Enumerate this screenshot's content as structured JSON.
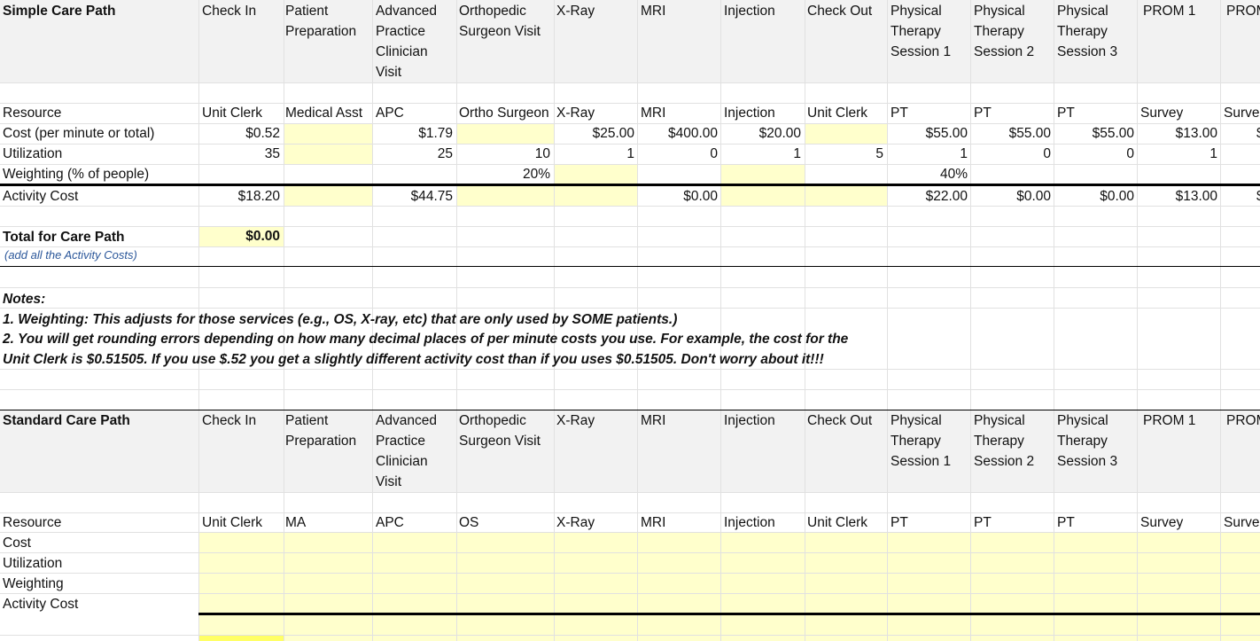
{
  "simple": {
    "title": "Simple Care Path",
    "headers": [
      "Check In",
      "Patient\nPreparation",
      "Advanced\nPractice\nClinician\nVisit",
      "Orthopedic\nSurgeon Visit",
      "X-Ray",
      "MRI",
      "Injection",
      "Check Out",
      "Physical\nTherapy\nSession 1",
      "Physical\nTherapy\nSession 2",
      "Physical\nTherapy\nSession 3",
      "PROM 1",
      "PROM"
    ],
    "row_labels": {
      "resource": "Resource",
      "cost": "Cost (per minute or total)",
      "utilization": "Utilization",
      "weighting": "Weighting (% of people)",
      "activity": "Activity Cost"
    },
    "resource": [
      "Unit Clerk",
      "Medical Asst",
      "APC",
      "Ortho Surgeon",
      "X-Ray",
      "MRI",
      "Injection",
      "Unit Clerk",
      "PT",
      "PT",
      "PT",
      "Survey",
      "Surve"
    ],
    "cost": [
      "$0.52",
      "",
      "$1.79",
      "",
      "$25.00",
      "$400.00",
      "$20.00",
      "",
      "$55.00",
      "$55.00",
      "$55.00",
      "$13.00",
      "$"
    ],
    "utilization": [
      "35",
      "",
      "25",
      "10",
      "1",
      "0",
      "1",
      "5",
      "1",
      "0",
      "0",
      "1",
      ""
    ],
    "weighting": [
      "",
      "",
      "",
      "20%",
      "",
      "",
      "",
      "",
      "40%",
      "",
      "",
      "",
      ""
    ],
    "activity": [
      "$18.20",
      "",
      "$44.75",
      "",
      "",
      "$0.00",
      "",
      "",
      "$22.00",
      "$0.00",
      "$0.00",
      "$13.00",
      "$"
    ],
    "total_label": "Total for Care Path",
    "total_value": "$0.00",
    "total_sub": "(add all the Activity Costs)"
  },
  "notes": {
    "title": "Notes:",
    "line1": "1. Weighting:  This adjusts for those services (e.g., OS, X-ray, etc) that are only used by SOME patients.)",
    "line2": "2. You will get rounding errors depending on how many decimal places of per minute costs you use.  For example, the cost for the",
    "line3": "Unit Clerk is $0.51505.  If you use $.52 you get a slightly different activity cost than if you uses $0.51505.  Don't worry about it!!!"
  },
  "standard": {
    "title": "Standard Care Path",
    "headers": [
      "Check In",
      "Patient\nPreparation",
      "Advanced\nPractice\nClinician\nVisit",
      "Orthopedic\nSurgeon Visit",
      "X-Ray",
      "MRI",
      "Injection",
      "Check Out",
      "Physical\nTherapy\nSession 1",
      "Physical\nTherapy\nSession 2",
      "Physical\nTherapy\nSession 3",
      "PROM 1",
      "PROM"
    ],
    "row_labels": {
      "resource": "Resource",
      "cost": "Cost",
      "utilization": "Utilization",
      "weighting": "Weighting",
      "activity": "Activity Cost"
    },
    "resource": [
      "Unit Clerk",
      "MA",
      "APC",
      "OS",
      "X-Ray",
      "MRI",
      "Injection",
      "Unit Clerk",
      "PT",
      "PT",
      "PT",
      "Survey",
      "Surve"
    ]
  },
  "colors": {
    "header_band": "#f2f2f2",
    "input_fill": "#ffffcc",
    "total_fill": "#ffff66"
  }
}
